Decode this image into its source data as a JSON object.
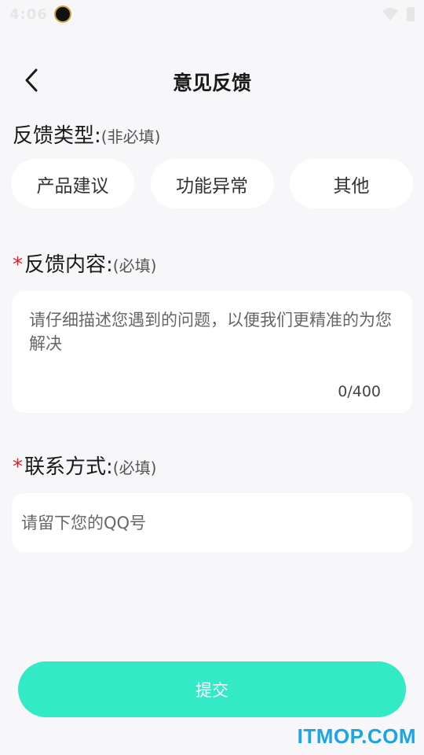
{
  "status_bar": {
    "time": "4:06",
    "icons": [
      "app-badge-icon",
      "wifi-icon",
      "battery-icon"
    ]
  },
  "nav": {
    "title": "意见反馈",
    "back_icon": "chevron-left-icon"
  },
  "feedback_type": {
    "label": "反馈类型:",
    "hint": "(非必填)",
    "options": [
      "产品建议",
      "功能异常",
      "其他"
    ]
  },
  "feedback_content": {
    "required_mark": "*",
    "label": "反馈内容:",
    "hint": "(必填)",
    "placeholder": "请仔细描述您遇到的问题，以便我们更精准的为您解决",
    "value": "",
    "counter": "0/400"
  },
  "contact": {
    "required_mark": "*",
    "label": "联系方式:",
    "hint": "(必填)",
    "placeholder": "请留下您的QQ号",
    "value": ""
  },
  "submit": {
    "label": "提交"
  },
  "watermark": "ITMOP.COM",
  "colors": {
    "accent": "#33eac6",
    "required": "#e0202c",
    "background": "#f7f7f9",
    "watermark": "#1aa5e5"
  }
}
